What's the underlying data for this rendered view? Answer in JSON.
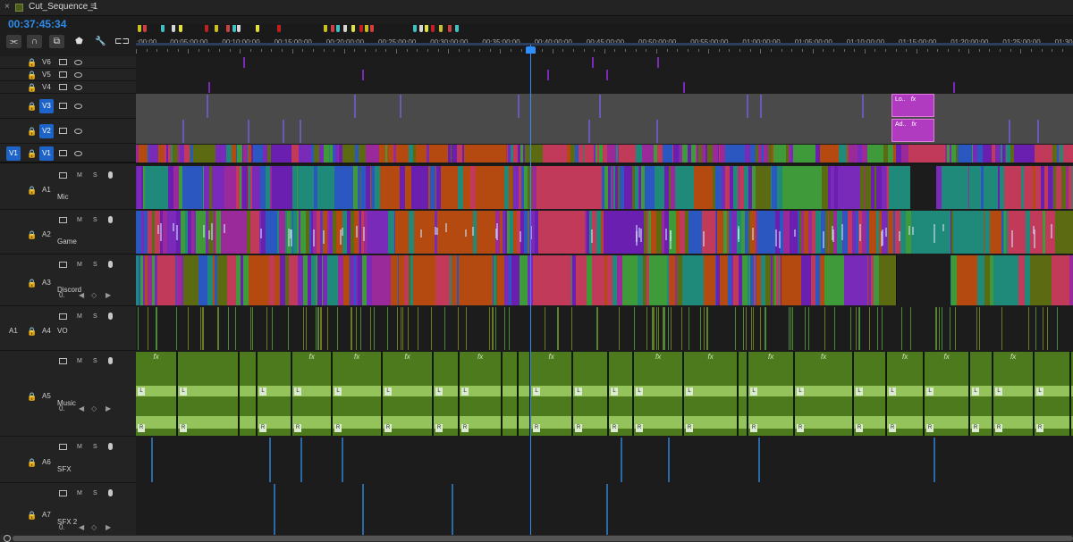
{
  "panel": {
    "close_glyph": "×",
    "title": "Cut_Sequence_1",
    "menu_glyph": "≡"
  },
  "timecode": "00:37:45:34",
  "toolbar": [
    "snap-in-tool",
    "magnet-icon",
    "linked-selection-icon",
    "marker-icon",
    "wrench-icon",
    "captions-icon"
  ],
  "ruler": {
    "labels": [
      ":00:00",
      "00:05:00:00",
      "00:10:00:00",
      "00:15:00:00",
      "00:20:00:00",
      "00:25:00:00",
      "00:30:00:00",
      "00:35:00:00",
      "00:40:00:00",
      "00:45:00:00",
      "00:50:00:00",
      "00:55:00:00",
      "01:00:00:00",
      "01:05:00:00",
      "01:10:00:00",
      "01:15:00:00",
      "01:20:00:00",
      "01:25:00:00",
      "01:30"
    ]
  },
  "tracks": {
    "video": [
      {
        "id": "V6",
        "target": ""
      },
      {
        "id": "V5",
        "target": ""
      },
      {
        "id": "V4",
        "target": ""
      },
      {
        "id": "V3",
        "target": ""
      },
      {
        "id": "V2",
        "target": ""
      },
      {
        "id": "V1",
        "target": "V1"
      }
    ],
    "audio": [
      {
        "id": "A1",
        "name": "Mic",
        "target": "",
        "mute": "M",
        "solo": "S"
      },
      {
        "id": "A2",
        "name": "Game",
        "target": "",
        "mute": "M",
        "solo": "S"
      },
      {
        "id": "A3",
        "name": "Discord",
        "target": "",
        "mute": "M",
        "solo": "S",
        "volume": "0."
      },
      {
        "id": "A4",
        "name": "VO",
        "target": "A1",
        "mute": "M",
        "solo": "S"
      },
      {
        "id": "A5",
        "name": "Music",
        "target": "",
        "mute": "M",
        "solo": "S",
        "volume": "0."
      },
      {
        "id": "A6",
        "name": "SFX",
        "target": "",
        "mute": "M",
        "solo": "S"
      },
      {
        "id": "A7",
        "name": "SFX 2",
        "target": "",
        "mute": "M",
        "solo": "S",
        "volume": "0."
      }
    ]
  },
  "fx_clips": [
    {
      "track": "V3",
      "label": "Lo..",
      "fx": "fx"
    },
    {
      "track": "V2",
      "label": "Ad..",
      "fx": "fx"
    }
  ],
  "music_fx": "fx",
  "channel_labels": {
    "left": "L",
    "right": "R"
  },
  "colors": {
    "playhead": "#2f8fff",
    "clip_palette": [
      "#6a1fb0",
      "#9a2a9a",
      "#b54a10",
      "#5c6a12",
      "#1f8a7a",
      "#c23a5a",
      "#2a58c0",
      "#3f9a3a",
      "#7a2ab8"
    ],
    "music": "#4e7a1e",
    "music_wave": "#a6d46a",
    "fx_clip": "#b03ac0",
    "timecode": "#2d8ceb"
  }
}
